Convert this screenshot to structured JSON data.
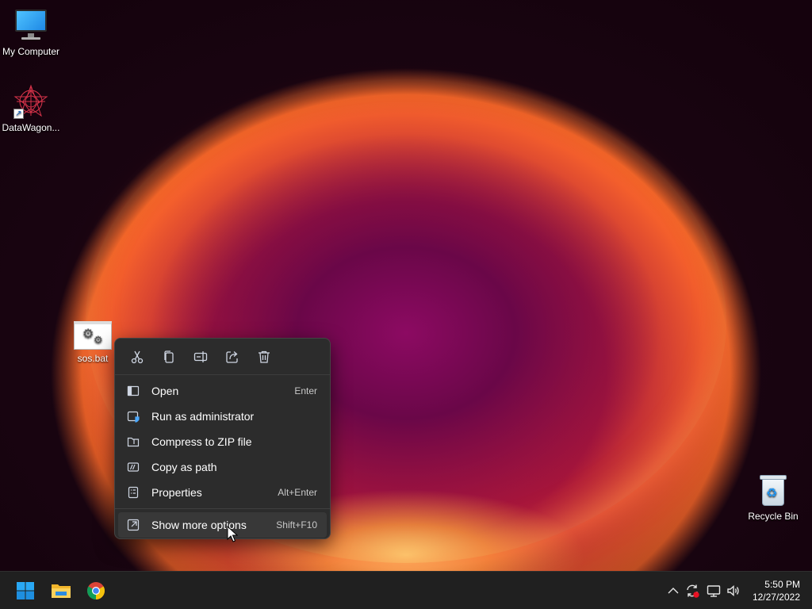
{
  "desktop": {
    "icons": [
      {
        "label": "My Computer",
        "icon": "computer-icon"
      },
      {
        "label": "DataWagon...",
        "icon": "datawagon-shortcut-icon"
      },
      {
        "label": "sos.bat",
        "icon": "batch-file-icon"
      },
      {
        "label": "Recycle Bin",
        "icon": "recycle-bin-icon"
      }
    ]
  },
  "context_menu": {
    "quick_actions": [
      {
        "name": "cut",
        "icon": "scissors-icon"
      },
      {
        "name": "copy",
        "icon": "copy-icon"
      },
      {
        "name": "rename",
        "icon": "rename-icon"
      },
      {
        "name": "share",
        "icon": "share-icon"
      },
      {
        "name": "delete",
        "icon": "trash-icon"
      }
    ],
    "items": [
      {
        "label": "Open",
        "shortcut": "Enter",
        "icon": "open-icon"
      },
      {
        "label": "Run as administrator",
        "shortcut": "",
        "icon": "shield-window-icon"
      },
      {
        "label": "Compress to ZIP file",
        "shortcut": "",
        "icon": "zip-folder-icon"
      },
      {
        "label": "Copy as path",
        "shortcut": "",
        "icon": "path-icon"
      },
      {
        "label": "Properties",
        "shortcut": "Alt+Enter",
        "icon": "properties-icon"
      },
      {
        "label": "Show more options",
        "shortcut": "Shift+F10",
        "icon": "more-options-icon"
      }
    ]
  },
  "taskbar": {
    "apps": [
      {
        "name": "Start",
        "icon": "windows-start-icon"
      },
      {
        "name": "File Explorer",
        "icon": "folder-icon"
      },
      {
        "name": "Google Chrome",
        "icon": "chrome-icon"
      }
    ],
    "tray": {
      "icons": [
        "chevron-up-icon",
        "sync-icon",
        "network-icon",
        "volume-icon"
      ],
      "time": "5:50 PM",
      "date": "12/27/2022"
    }
  },
  "colors": {
    "menu_bg": "#2c2c2c",
    "taskbar_bg": "#202020",
    "accent_blue": "#0078d4"
  }
}
